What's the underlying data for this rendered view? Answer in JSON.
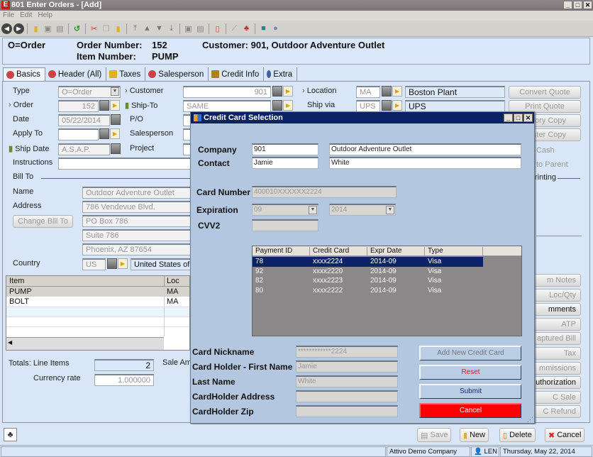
{
  "window": {
    "title": "801 Enter Orders - [Add]",
    "app_icon": "E"
  },
  "menu": [
    "File",
    "Edit",
    "Help"
  ],
  "toolbar_icons": [
    "back-icon",
    "forward-icon",
    "new-icon",
    "copy-record-icon",
    "save-icon",
    "undo-icon",
    "cut-icon",
    "copy-icon",
    "paste-icon",
    "first-record-icon",
    "prev-record-icon",
    "next-record-icon",
    "last-record-icon",
    "print-preview-icon",
    "print-icon",
    "report-icon",
    "chart-icon",
    "people-icon",
    "screen-icon",
    "help-icon"
  ],
  "header": {
    "type": "O=Order",
    "order_number_label": "Order Number:",
    "order_number": "152",
    "item_number_label": "Item Number:",
    "item_number": "PUMP",
    "customer": "Customer: 901, Outdoor Adventure Outlet"
  },
  "tabs": [
    {
      "label": "Basics",
      "active": true
    },
    {
      "label": "Header (All)"
    },
    {
      "label": "Taxes"
    },
    {
      "label": "Salesperson"
    },
    {
      "label": "Credit Info"
    },
    {
      "label": "Extra"
    }
  ],
  "form": {
    "type_label": "Type",
    "type_value": "O=Order",
    "order_label": "Order",
    "order_value": "152",
    "date_label": "Date",
    "date_value": "05/22/2014",
    "apply_to_label": "Apply To",
    "apply_to_value": "",
    "ship_date_label": "Ship Date",
    "ship_date_value": "A.S.A.P.",
    "instructions_label": "Instructions",
    "instructions_value": "",
    "customer_label": "Customer",
    "customer_value": "901",
    "ship_to_label": "Ship-To",
    "ship_to_value": "SAME",
    "po_label": "P/O",
    "salesperson_label": "Salesperson",
    "project_label": "Project",
    "location_label": "Location",
    "location_code": "MA",
    "location_name": "Boston Plant",
    "ship_via_label": "Ship via",
    "ship_via_code": "UPS",
    "ship_via_name": "UPS",
    "bill_to_label": "Bill To",
    "name_label": "Name",
    "name_value": "Outdoor Adventure Outlet",
    "address_label": "Address",
    "address_lines": [
      "786 Vendevue Blvd.",
      "PO Box 786",
      "Suite 786",
      "Phoenix, AZ 87654"
    ],
    "change_bill_to": "Change Bill To",
    "country_label": "Country",
    "country_code": "US",
    "country_name": "United States of"
  },
  "right_buttons": [
    "Convert Quote",
    "Print Quote",
    "tory Copy",
    "ster Copy"
  ],
  "right_labels": {
    "cash": "Cash",
    "to_parent": "to Parent",
    "printing": "rinting"
  },
  "right_lower_buttons": [
    {
      "label": "m Notes",
      "enabled": false
    },
    {
      "label": "Loc/Qty",
      "enabled": false
    },
    {
      "label": "mments",
      "enabled": true
    },
    {
      "label": "ATP",
      "enabled": false
    },
    {
      "label": "aptured Bill",
      "enabled": false
    },
    {
      "label": "Tax",
      "enabled": false
    },
    {
      "label": "mmissions",
      "enabled": false
    },
    {
      "label": "uthorization",
      "enabled": true
    },
    {
      "label": "C Sale",
      "enabled": false
    },
    {
      "label": "C Refund",
      "enabled": false
    }
  ],
  "grid": {
    "columns": [
      "Item",
      "Loc"
    ],
    "rows": [
      [
        "PUMP",
        "MA"
      ],
      [
        "BOLT",
        "MA"
      ]
    ]
  },
  "totals": {
    "line_items_label": "Totals: Line Items",
    "line_items_value": "2",
    "currency_rate_label": "Currency rate",
    "currency_rate_value": "1.000000",
    "sale_amount_label": "Sale Am"
  },
  "dialog": {
    "title": "Credit Card Selection",
    "company_label": "Company",
    "company_code": "901",
    "company_name": "Outdoor Adventure Outlet",
    "contact_label": "Contact",
    "contact_first": "Jamie",
    "contact_last": "White",
    "card_number_label": "Card Number",
    "card_number": "400010XXXXXX2224",
    "expiration_label": "Expiration",
    "exp_month": "09",
    "exp_year": "2014",
    "cvv2_label": "CVV2",
    "cvv2_value": "",
    "list_columns": [
      "Payment ID",
      "Credit Card",
      "Expr Date",
      "Type"
    ],
    "list_rows": [
      [
        "78",
        "xxxx2224",
        "2014-09",
        "Visa"
      ],
      [
        "92",
        "xxxx2220",
        "2014-09",
        "Visa"
      ],
      [
        "82",
        "xxxx2223",
        "2014-09",
        "Visa"
      ],
      [
        "80",
        "xxxx2222",
        "2014-09",
        "Visa"
      ]
    ],
    "selected_row": 0,
    "nickname_label": "Card Nickname",
    "nickname_value": "************2224",
    "holder_first_label": "Card Holder - First Name",
    "holder_first_value": "Jamie",
    "last_name_label": "Last Name",
    "last_name_value": "White",
    "address_label": "CardHolder Address",
    "address_value": "",
    "zip_label": "CardHolder Zip",
    "zip_value": "",
    "add_button": "Add New Credit Card",
    "reset_button": "Reset",
    "submit_button": "Submit",
    "cancel_button": "Cancel",
    "colors": {
      "cancel_bg": "#ff0000",
      "reset_text": "#cc2233",
      "title_bg": "#0b2365"
    }
  },
  "bottom_buttons": {
    "save": "Save",
    "new": "New",
    "delete": "Delete",
    "cancel": "Cancel"
  },
  "status": {
    "company": "Attivo Demo Company",
    "user": "LEN",
    "date": "Thursday, May 22, 2014"
  }
}
